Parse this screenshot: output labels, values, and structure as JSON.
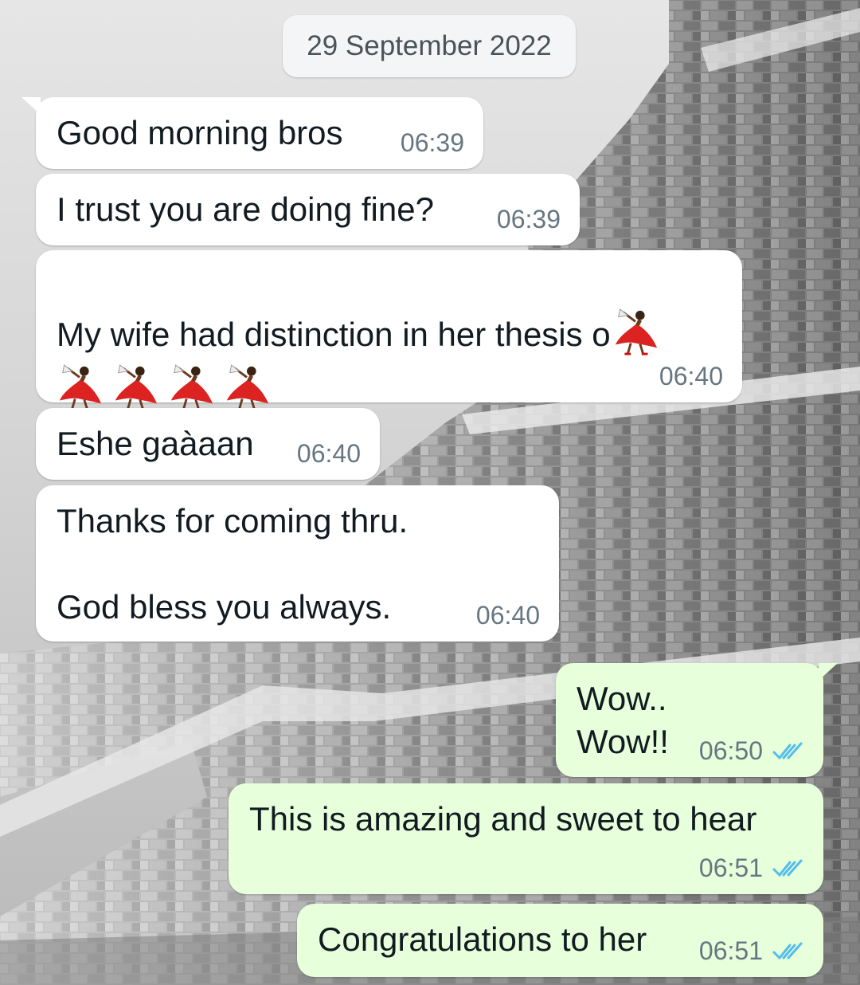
{
  "chat": {
    "date_label": "29 September 2022",
    "messages": [
      {
        "direction": "incoming",
        "text": "Good morning bros",
        "time": "06:39"
      },
      {
        "direction": "incoming",
        "text": "I trust you are doing fine?",
        "time": "06:39"
      },
      {
        "direction": "incoming",
        "text": "My wife had distinction in her thesis o",
        "emoji": "woman-dancing-icon",
        "emoji_count": 5,
        "time": "06:40"
      },
      {
        "direction": "incoming",
        "text": "Eshe gaàaan",
        "time": "06:40"
      },
      {
        "direction": "incoming",
        "text": "Thanks for coming thru.\n\nGod bless you always.",
        "time": "06:40"
      },
      {
        "direction": "outgoing",
        "text": "Wow..\nWow!!",
        "time": "06:50",
        "status": "read"
      },
      {
        "direction": "outgoing",
        "text": "This is amazing and sweet to hear",
        "time": "06:51",
        "status": "read"
      },
      {
        "direction": "outgoing",
        "text": "Congratulations to her",
        "time": "06:51",
        "status": "read"
      }
    ]
  },
  "colors": {
    "incoming_bubble": "#ffffff",
    "outgoing_bubble": "#e7ffdb",
    "read_tick": "#53bdeb",
    "timestamp": "#667781",
    "date_chip": "#f4f5f6"
  }
}
